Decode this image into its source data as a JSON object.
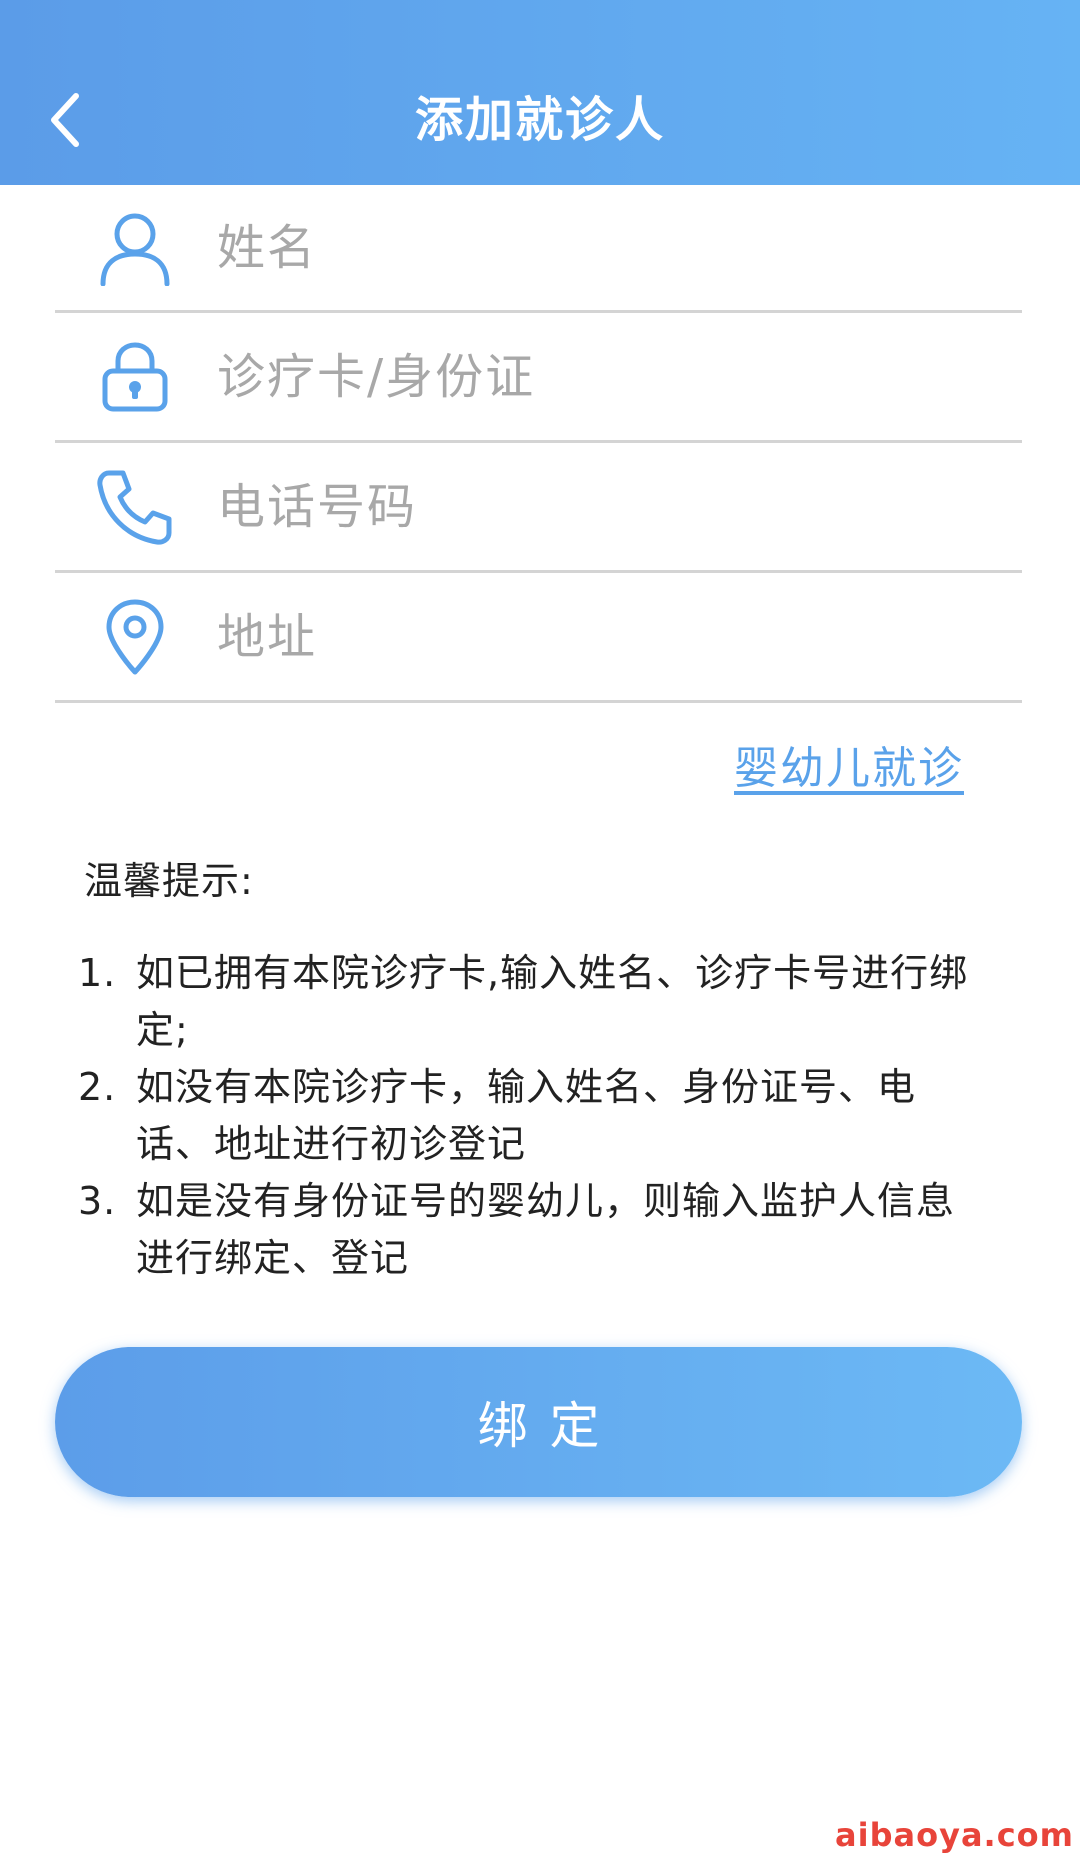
{
  "header": {
    "title": "添加就诊人",
    "back_icon": "chevron-left-icon"
  },
  "form": {
    "name": {
      "placeholder": "姓名",
      "value": "",
      "icon": "user-icon"
    },
    "card": {
      "placeholder": "诊疗卡/身份证",
      "value": "",
      "icon": "lock-icon"
    },
    "phone": {
      "placeholder": "电话号码",
      "value": "",
      "icon": "phone-icon"
    },
    "address": {
      "placeholder": "地址",
      "value": "",
      "icon": "location-pin-icon"
    }
  },
  "infant_link": "婴幼儿就诊",
  "tips": {
    "title": "温馨提示:",
    "items": [
      {
        "num": "1.",
        "text": "如已拥有本院诊疗卡,输入姓名、诊疗卡号进行绑定;"
      },
      {
        "num": "2.",
        "text": "如没有本院诊疗卡，输入姓名、身份证号、电话、地址进行初诊登记"
      },
      {
        "num": "3.",
        "text": "如是没有身份证号的婴幼儿，则输入监护人信息进行绑定、登记"
      }
    ]
  },
  "bind_button": "绑定",
  "watermark": "aibaoya.com",
  "colors": {
    "primary": "#5b9ce8",
    "primary_light": "#66b3f4",
    "link": "#5aa2ea",
    "placeholder": "#a8a8a8",
    "divider": "#d4d4d4",
    "watermark": "#e8443a"
  }
}
